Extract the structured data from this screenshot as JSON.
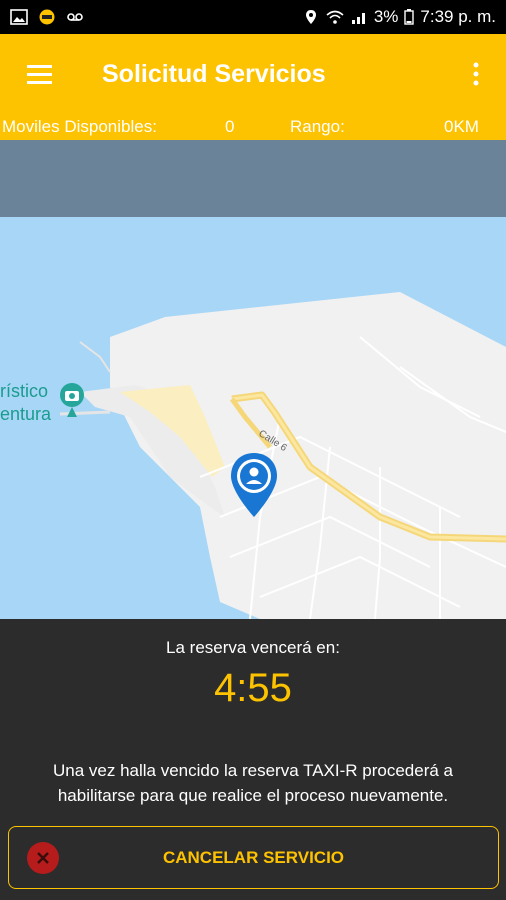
{
  "statusbar": {
    "battery": "3%",
    "time": "7:39 p. m."
  },
  "appbar": {
    "title": "Solicitud Servicios"
  },
  "info": {
    "moviles_label": "Moviles Disponibles:",
    "moviles_value": "0",
    "rango_label": "Rango:",
    "rango_value": "0KM"
  },
  "map": {
    "street_label": "Calle 6",
    "poi_line1": "rístico",
    "poi_line2": "entura"
  },
  "reservation": {
    "label": "La reserva vencerá en:",
    "timer": "4:55",
    "message_line1": "Una vez halla vencido la reserva TAXI-R procederá a",
    "message_line2": "habilitarse para que realice el proceso nuevamente."
  },
  "cancel": {
    "label": "CANCELAR SERVICIO"
  },
  "colors": {
    "accent": "#fdc200",
    "map_water": "#a8d6f7",
    "map_land": "#f1f1f1",
    "cancel_icon": "#b71c1c"
  }
}
